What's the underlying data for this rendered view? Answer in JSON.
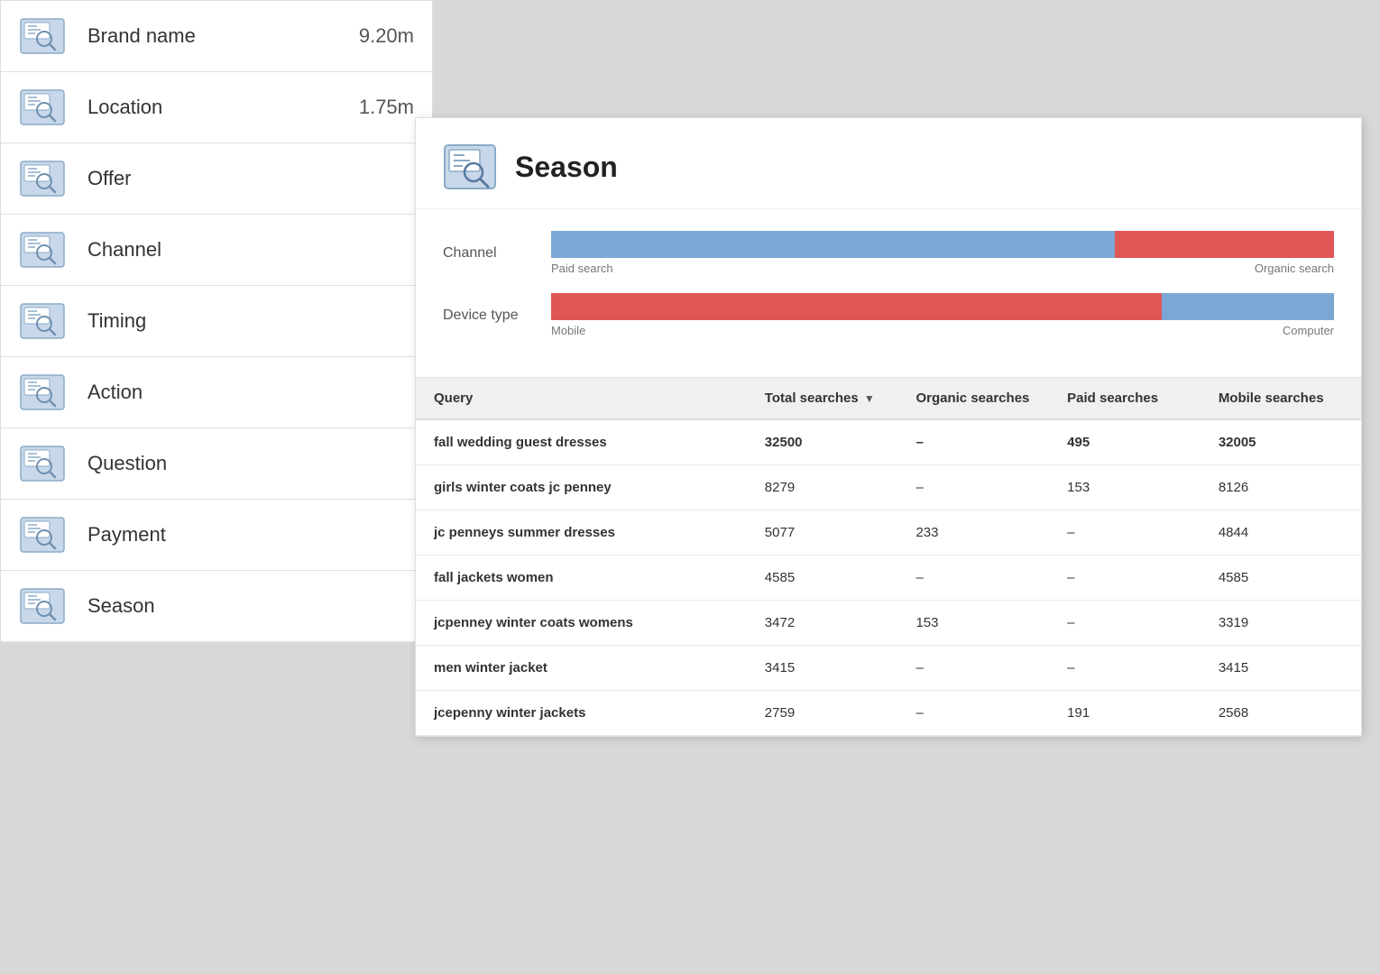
{
  "leftPanel": {
    "items": [
      {
        "id": "brand-name",
        "label": "Brand name",
        "value": "9.20m"
      },
      {
        "id": "location",
        "label": "Location",
        "value": "1.75m"
      },
      {
        "id": "offer",
        "label": "Offer",
        "value": ""
      },
      {
        "id": "channel",
        "label": "Channel",
        "value": ""
      },
      {
        "id": "timing",
        "label": "Timing",
        "value": ""
      },
      {
        "id": "action",
        "label": "Action",
        "value": ""
      },
      {
        "id": "question",
        "label": "Question",
        "value": ""
      },
      {
        "id": "payment",
        "label": "Payment",
        "value": ""
      },
      {
        "id": "season",
        "label": "Season",
        "value": ""
      }
    ]
  },
  "detail": {
    "title": "Season",
    "charts": {
      "channel": {
        "label": "Channel",
        "blueLabel": "Paid search",
        "redLabel": "Organic search",
        "bluePercent": 72,
        "redPercent": 28
      },
      "deviceType": {
        "label": "Device type",
        "redLabel": "Mobile",
        "blueLabel": "Computer",
        "redPercent": 78,
        "bluePercent": 22
      }
    },
    "table": {
      "columns": [
        {
          "id": "query",
          "label": "Query",
          "sortable": false
        },
        {
          "id": "total",
          "label": "Total searches",
          "sortable": true
        },
        {
          "id": "organic",
          "label": "Organic searches",
          "sortable": false
        },
        {
          "id": "paid",
          "label": "Paid searches",
          "sortable": false
        },
        {
          "id": "mobile",
          "label": "Mobile searches",
          "sortable": false
        }
      ],
      "rows": [
        {
          "query": "fall wedding guest dresses",
          "total": "32500",
          "organic": "–",
          "paid": "495",
          "mobile": "32005"
        },
        {
          "query": "girls winter coats jc penney",
          "total": "8279",
          "organic": "–",
          "paid": "153",
          "mobile": "8126"
        },
        {
          "query": "jc penneys summer dresses",
          "total": "5077",
          "organic": "233",
          "paid": "–",
          "mobile": "4844"
        },
        {
          "query": "fall jackets women",
          "total": "4585",
          "organic": "–",
          "paid": "–",
          "mobile": "4585"
        },
        {
          "query": "jcpenney winter coats womens",
          "total": "3472",
          "organic": "153",
          "paid": "–",
          "mobile": "3319"
        },
        {
          "query": "men winter jacket",
          "total": "3415",
          "organic": "–",
          "paid": "–",
          "mobile": "3415"
        },
        {
          "query": "jcepenny winter jackets",
          "total": "2759",
          "organic": "–",
          "paid": "191",
          "mobile": "2568"
        }
      ]
    }
  }
}
